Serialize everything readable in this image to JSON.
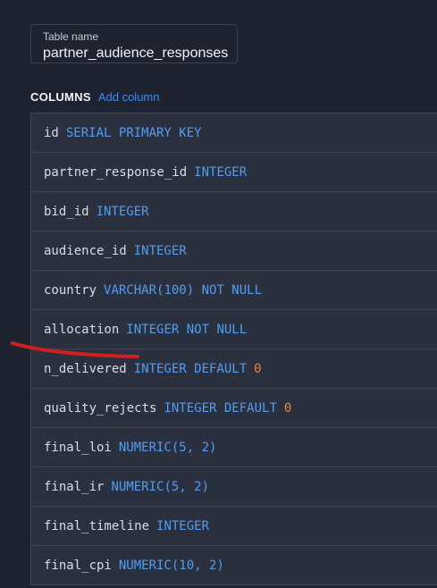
{
  "table_name": {
    "label": "Table name",
    "value": "partner_audience_responses"
  },
  "columns_section": {
    "title": "COLUMNS",
    "add_label": "Add column"
  },
  "columns": [
    {
      "name": "id",
      "type": "SERIAL PRIMARY KEY",
      "default": ""
    },
    {
      "name": "partner_response_id",
      "type": "INTEGER",
      "default": ""
    },
    {
      "name": "bid_id",
      "type": "INTEGER",
      "default": ""
    },
    {
      "name": "audience_id",
      "type": "INTEGER",
      "default": ""
    },
    {
      "name": "country",
      "type": "VARCHAR(100) NOT NULL",
      "default": ""
    },
    {
      "name": "allocation",
      "type": "INTEGER NOT NULL",
      "default": ""
    },
    {
      "name": "n_delivered",
      "type": "INTEGER DEFAULT",
      "default": "0"
    },
    {
      "name": "quality_rejects",
      "type": "INTEGER DEFAULT",
      "default": "0"
    },
    {
      "name": "final_loi",
      "type": "NUMERIC(5, 2)",
      "default": ""
    },
    {
      "name": "final_ir",
      "type": "NUMERIC(5, 2)",
      "default": ""
    },
    {
      "name": "final_timeline",
      "type": "INTEGER",
      "default": ""
    },
    {
      "name": "final_cpi",
      "type": "NUMERIC(10, 2)",
      "default": ""
    }
  ],
  "colors": {
    "background": "#1f2330",
    "row_background": "#2b303e",
    "type_keyword": "#4f9df5",
    "default_value": "#f0853a",
    "link": "#3b8df2",
    "annotation_stroke": "#d11f1f"
  }
}
